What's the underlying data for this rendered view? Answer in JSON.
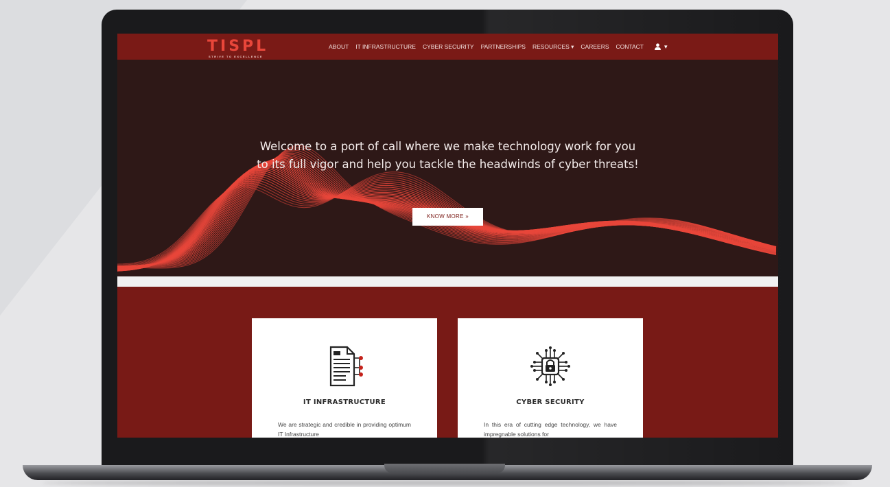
{
  "brand": {
    "name": "TISPL",
    "tagline": "STRIVE TO EXCELLENCE",
    "accent_color": "#e8463a",
    "nav_color": "#7a1a16",
    "hero_color": "#2e1817"
  },
  "nav": {
    "items": [
      {
        "label": "ABOUT"
      },
      {
        "label": "IT INFRASTRUCTURE"
      },
      {
        "label": "CYBER SECURITY"
      },
      {
        "label": "PARTNERSHIPS"
      },
      {
        "label": "RESOURCES ▾"
      },
      {
        "label": "CAREERS"
      },
      {
        "label": "CONTACT"
      }
    ],
    "user_icon": "user-icon",
    "user_caret": "▾"
  },
  "hero": {
    "line1": "Welcome to a port of call where we make technology work for you",
    "line2": "to its full vigor and help you tackle the headwinds of cyber threats!",
    "button_label": "KNOW MORE »"
  },
  "services": {
    "cards": [
      {
        "icon": "document-network-icon",
        "title": "IT INFRASTRUCTURE",
        "description": "We are strategic and credible in providing optimum IT Infrastructure"
      },
      {
        "icon": "circuit-lock-icon",
        "title": "CYBER SECURITY",
        "description": "In this era of cutting edge technology, we have impregnable solutions for"
      }
    ]
  }
}
